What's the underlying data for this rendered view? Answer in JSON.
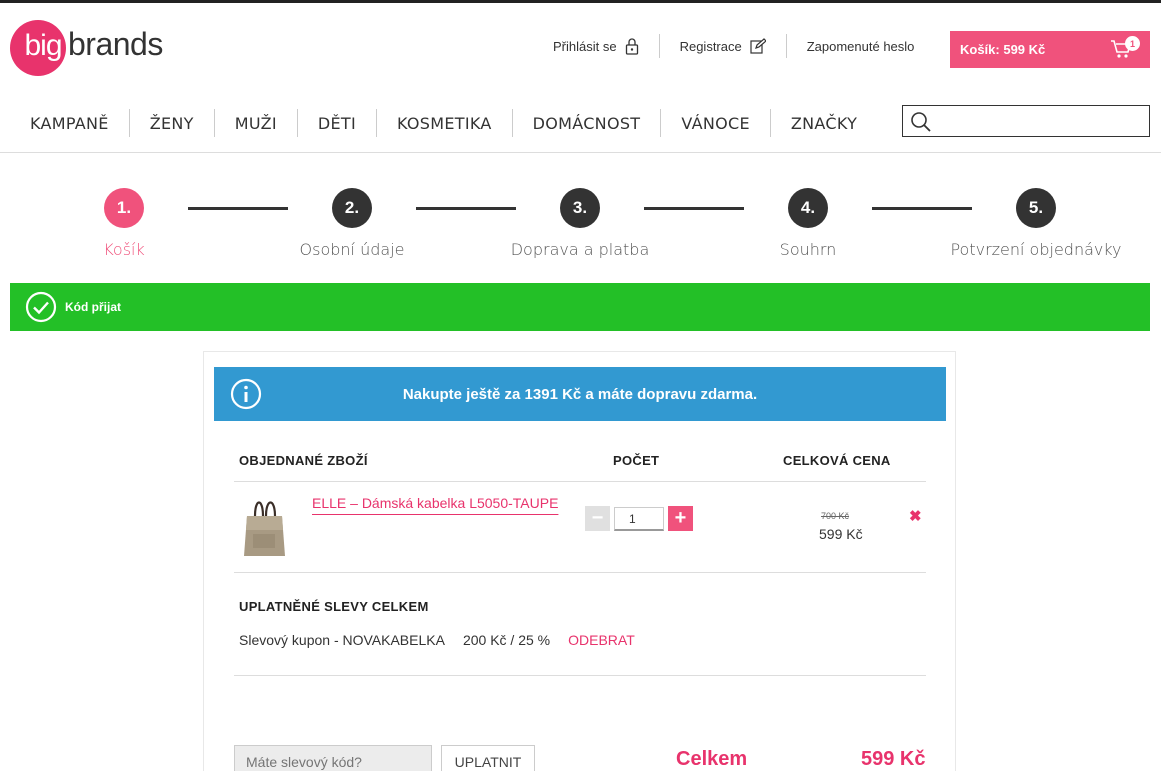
{
  "brand": {
    "logo_part1": "big",
    "logo_part2": "brands"
  },
  "header": {
    "login": "Přihlásit se",
    "register": "Registrace",
    "forgot": "Zapomenuté heslo",
    "cart_label": "Košík: 599 Kč",
    "cart_count": "1"
  },
  "nav": {
    "items": [
      "KAMPANĚ",
      "ŽENY",
      "MUŽI",
      "DĚTI",
      "KOSMETIKA",
      "DOMÁCNOST",
      "VÁNOCE",
      "ZNAČKY"
    ],
    "search_placeholder": ""
  },
  "steps": [
    {
      "num": "1.",
      "label": "Košík",
      "active": true
    },
    {
      "num": "2.",
      "label": "Osobní údaje",
      "active": false
    },
    {
      "num": "3.",
      "label": "Doprava a platba",
      "active": false
    },
    {
      "num": "4.",
      "label": "Souhrn",
      "active": false
    },
    {
      "num": "5.",
      "label": "Potvrzení objednávky",
      "active": false
    }
  ],
  "success": {
    "message": "Kód přijat"
  },
  "info": {
    "message": "Nakupte ještě za 1391 Kč a máte dopravu zdarma."
  },
  "table": {
    "col_item": "OBJEDNANÉ ZBOŽÍ",
    "col_qty": "POČET",
    "col_price": "CELKOVÁ CENA"
  },
  "product": {
    "name": "ELLE – Dámská kabelka L5050-TAUPE",
    "qty": "1",
    "price_old": "700 Kč",
    "price_new": "599 Kč",
    "minus": "−",
    "plus": "+",
    "remove": "✖"
  },
  "discounts": {
    "title": "UPLATNĚNÉ SLEVY CELKEM",
    "name": "Slevový kupon - NOVAKABELKA",
    "amount": "200 Kč / 25 %",
    "remove": "ODEBRAT"
  },
  "coupon": {
    "placeholder": "Máte slevový kód?",
    "apply": "UPLATNIT"
  },
  "total": {
    "label": "Celkem",
    "value": "599 Kč"
  },
  "colors": {
    "accent": "#f0527c",
    "success": "#23c027",
    "info": "#3299d1"
  }
}
